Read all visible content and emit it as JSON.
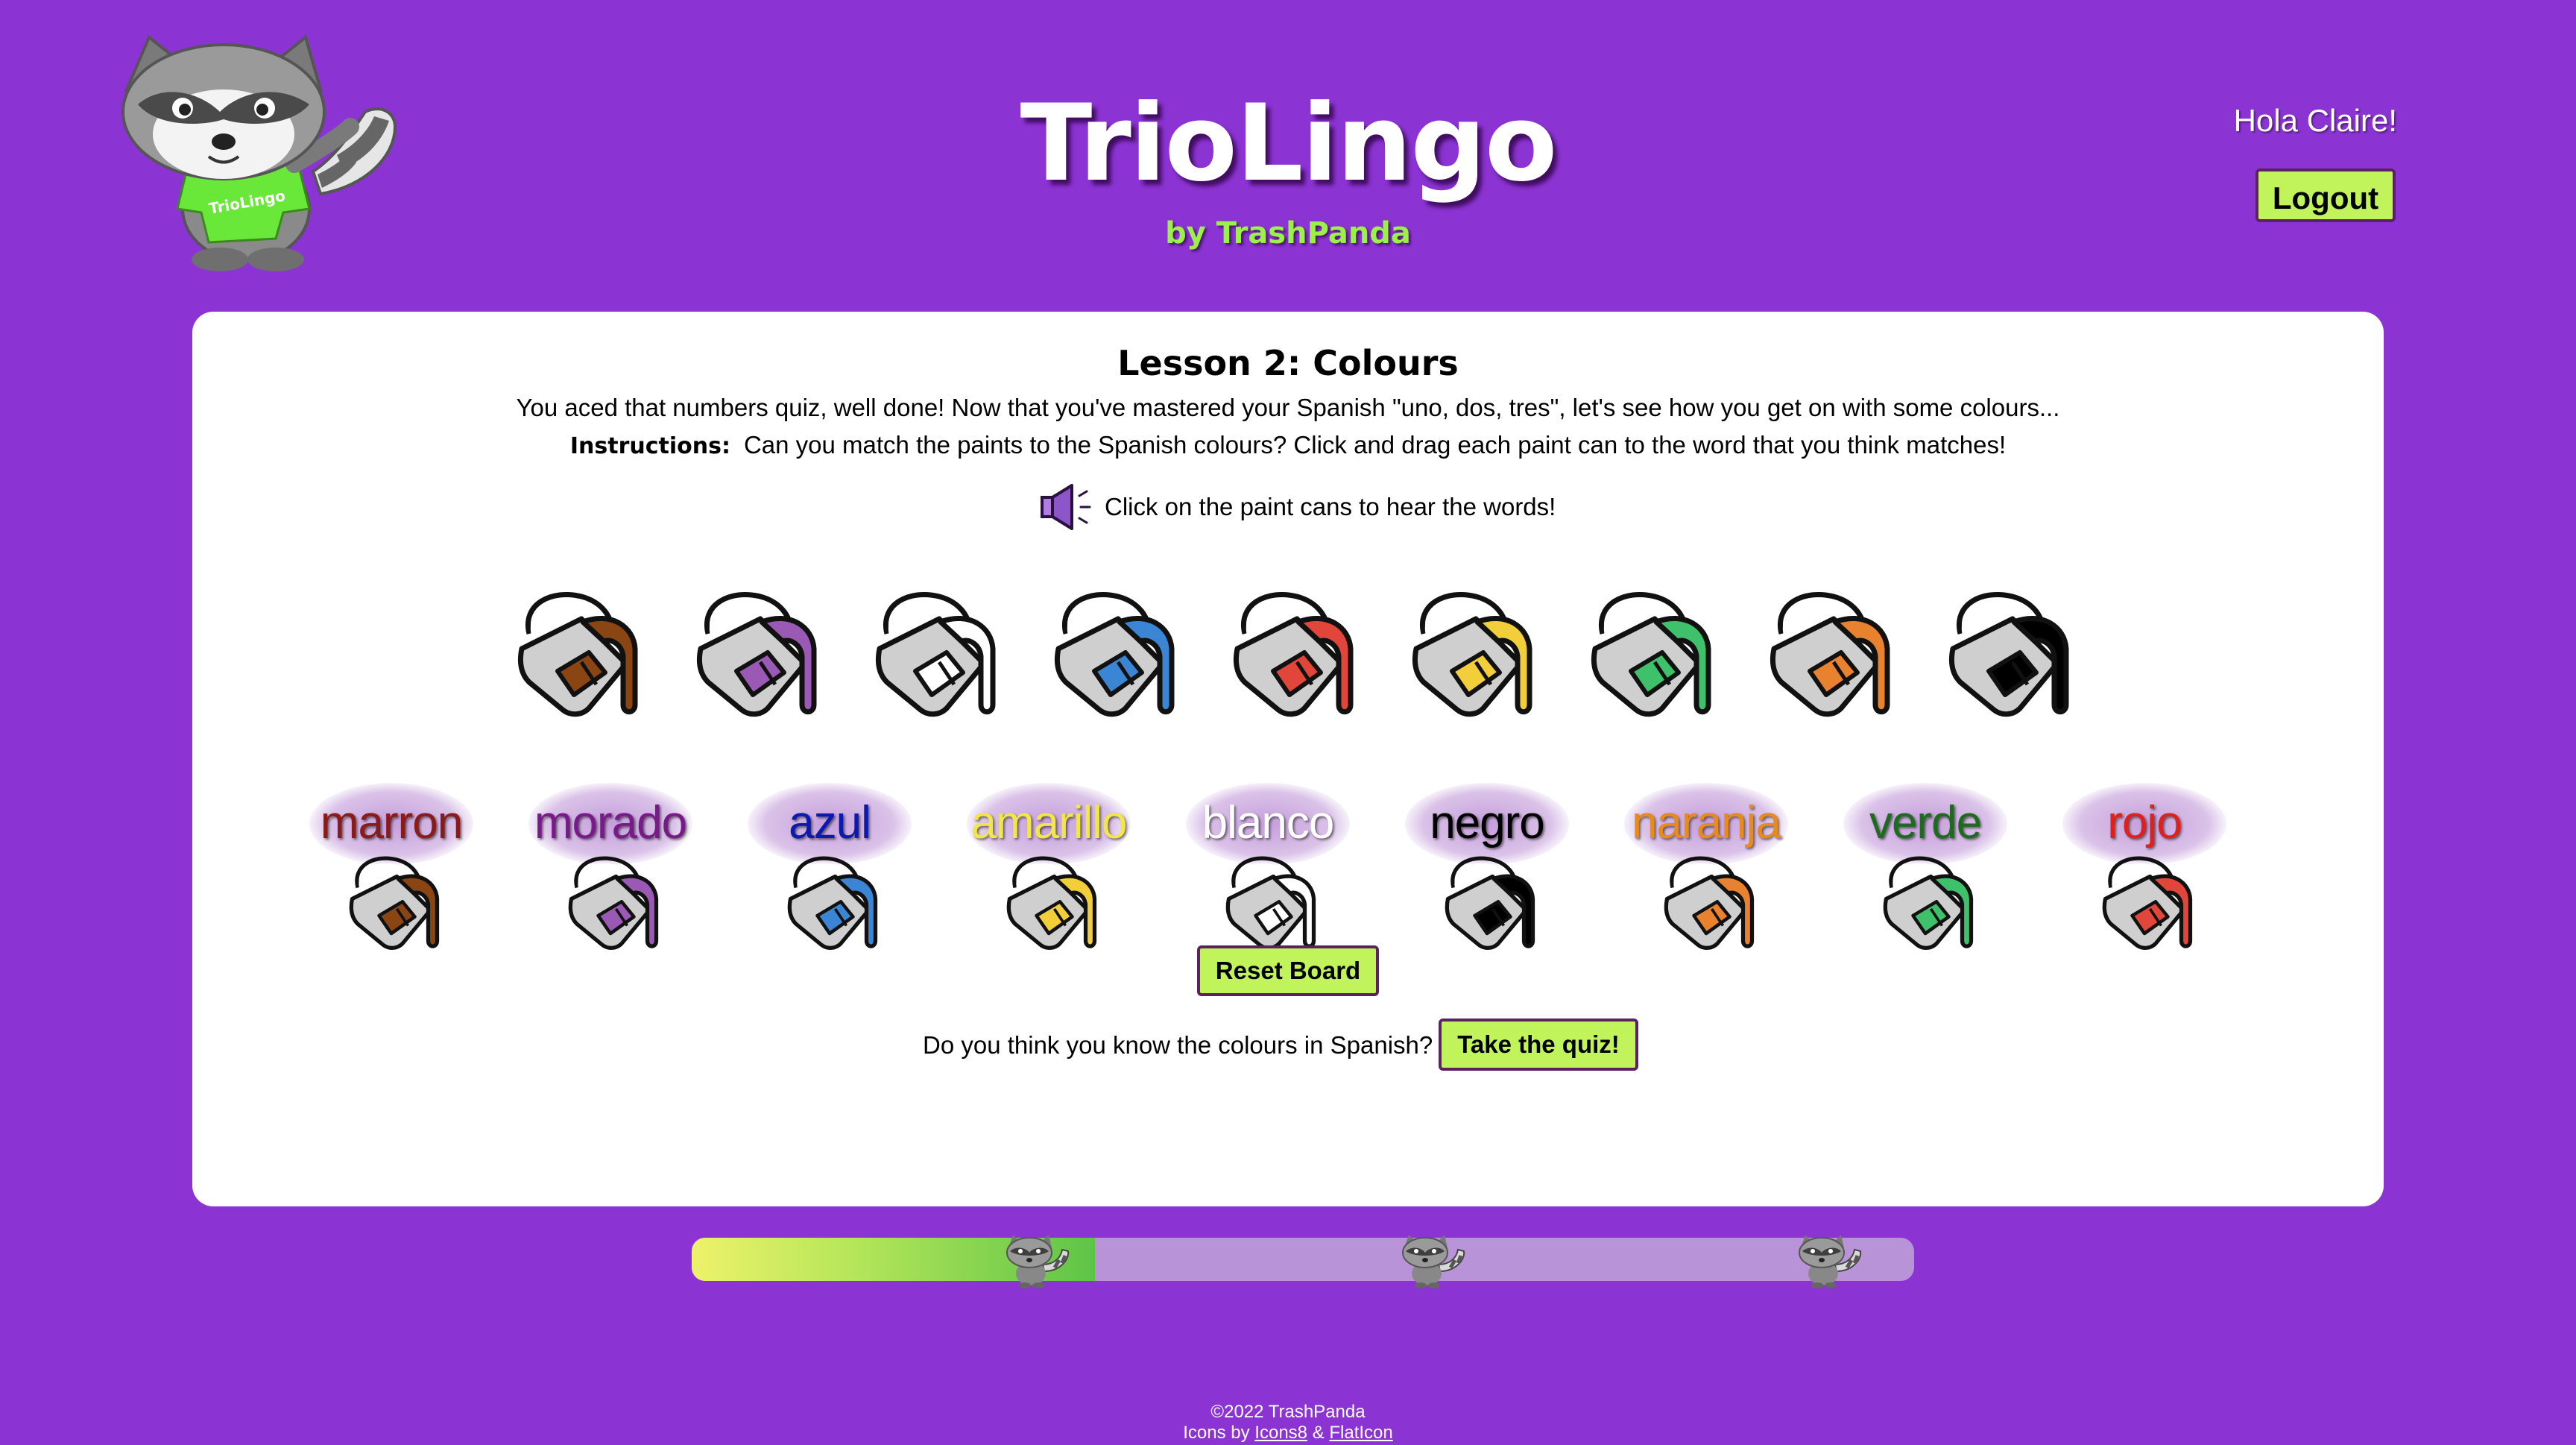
{
  "app": {
    "title": "TrioLingo",
    "subtitle": "by TrashPanda",
    "mascot_shirt_text": "TrioLingo"
  },
  "header": {
    "greeting": "Hola Claire!",
    "logout_label": "Logout"
  },
  "lesson": {
    "title": "Lesson 2: Colours",
    "intro": "You aced that numbers quiz, well done! Now that you've mastered your Spanish \"uno, dos, tres\", let's see how you get on with some colours...",
    "instructions_label": "Instructions:",
    "instructions_text": "Can you match the paints to the Spanish colours? Click and drag each paint can to the word that you think matches!",
    "audio_hint": "Click on the paint cans to hear the words!"
  },
  "paint_cans": [
    {
      "color_name": "brown",
      "hex": "#8b4513"
    },
    {
      "color_name": "purple",
      "hex": "#9b59b6"
    },
    {
      "color_name": "white",
      "hex": "#ffffff"
    },
    {
      "color_name": "blue",
      "hex": "#3a86d4"
    },
    {
      "color_name": "red",
      "hex": "#e2463a"
    },
    {
      "color_name": "yellow",
      "hex": "#f2cf3a"
    },
    {
      "color_name": "green",
      "hex": "#3fc06a"
    },
    {
      "color_name": "orange",
      "hex": "#e9822f"
    },
    {
      "color_name": "black",
      "hex": "#000000"
    }
  ],
  "words": [
    {
      "label": "marron",
      "text_color": "#8b1a1a",
      "paint_hex": "#8b4513"
    },
    {
      "label": "morado",
      "text_color": "#7a1a8a",
      "paint_hex": "#9b59b6"
    },
    {
      "label": "azul",
      "text_color": "#0a1ab0",
      "paint_hex": "#3a86d4"
    },
    {
      "label": "amarillo",
      "text_color": "#f2e64a",
      "paint_hex": "#f2cf3a"
    },
    {
      "label": "blanco",
      "text_color": "#ffffff",
      "paint_hex": "#ffffff"
    },
    {
      "label": "negro",
      "text_color": "#000000",
      "paint_hex": "#000000"
    },
    {
      "label": "naranja",
      "text_color": "#e88a1c",
      "paint_hex": "#e9822f"
    },
    {
      "label": "verde",
      "text_color": "#1d6b1d",
      "paint_hex": "#3fc06a"
    },
    {
      "label": "rojo",
      "text_color": "#e0201c",
      "paint_hex": "#e2463a"
    }
  ],
  "controls": {
    "reset_label": "Reset Board",
    "quiz_question": "Do you think you know the colours in Spanish?",
    "quiz_label": "Take the quiz!"
  },
  "progress": {
    "completed_fraction": 0.33,
    "milestones": 3
  },
  "footer": {
    "copyright": "©2022 TrashPanda",
    "icons_prefix": "Icons by",
    "icons8": "Icons8",
    "amp": "&",
    "flaticon": "FlatIcon"
  },
  "colors": {
    "background": "#8c33d4",
    "accent_button": "#c1f35a",
    "button_border": "#5b2161",
    "subtitle": "#9cf04a"
  }
}
